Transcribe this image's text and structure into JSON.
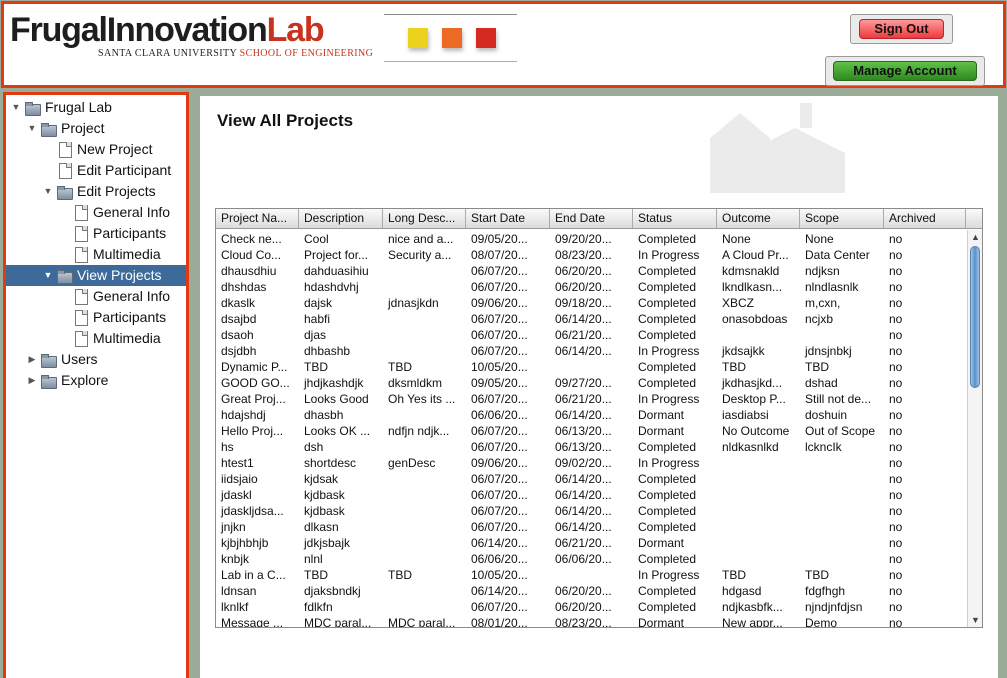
{
  "header": {
    "logo_part1": "FrugalInnovation",
    "logo_part2": "Lab",
    "logo_sub_university": "SANTA CLARA UNIVERSITY",
    "logo_sub_school": "SCHOOL OF ENGINEERING",
    "swatch_colors": [
      "#ecd21c",
      "#ec6a24",
      "#d42a22"
    ],
    "sign_out_label": "Sign Out",
    "manage_account_label": "Manage Account"
  },
  "tree": [
    {
      "label": "Frugal Lab",
      "type": "folder",
      "depth": 0,
      "expanded": true
    },
    {
      "label": "Project",
      "type": "folder",
      "depth": 1,
      "expanded": true
    },
    {
      "label": "New Project",
      "type": "page",
      "depth": 2
    },
    {
      "label": "Edit Participant",
      "type": "page",
      "depth": 2
    },
    {
      "label": "Edit Projects",
      "type": "folder",
      "depth": 2,
      "expanded": true
    },
    {
      "label": "General Info",
      "type": "page",
      "depth": 3
    },
    {
      "label": "Participants",
      "type": "page",
      "depth": 3
    },
    {
      "label": "Multimedia",
      "type": "page",
      "depth": 3
    },
    {
      "label": "View Projects",
      "type": "folder",
      "depth": 2,
      "expanded": true,
      "selected": true
    },
    {
      "label": "General Info",
      "type": "page",
      "depth": 3
    },
    {
      "label": "Participants",
      "type": "page",
      "depth": 3
    },
    {
      "label": "Multimedia",
      "type": "page",
      "depth": 3
    },
    {
      "label": "Users",
      "type": "folder",
      "depth": 1,
      "expanded": false
    },
    {
      "label": "Explore",
      "type": "folder",
      "depth": 1,
      "expanded": false
    }
  ],
  "main": {
    "title": "View All Projects",
    "columns": [
      "Project Na...",
      "Description",
      "Long Desc...",
      "Start Date",
      "End Date",
      "Status",
      "Outcome",
      "Scope",
      "Archived"
    ],
    "rows": [
      [
        "Check ne...",
        "Cool",
        "nice and a...",
        "09/05/20...",
        "09/20/20...",
        "Completed",
        "None",
        "None",
        "no"
      ],
      [
        "Cloud Co...",
        "Project for...",
        "Security a...",
        "08/07/20...",
        "08/23/20...",
        "In Progress",
        "A Cloud Pr...",
        "Data Center",
        "no"
      ],
      [
        "dhausdhiu",
        "dahduasihiu",
        "",
        "06/07/20...",
        "06/20/20...",
        "Completed",
        "kdmsnakld",
        "ndjksn",
        "no"
      ],
      [
        "dhshdas",
        "hdashdvhj",
        "",
        "06/07/20...",
        "06/20/20...",
        "Completed",
        "lkndlkasn...",
        "nlndlasnlk",
        "no"
      ],
      [
        "dkaslk",
        "dajsk",
        "jdnasjkdn",
        "09/06/20...",
        "09/18/20...",
        "Completed",
        "XBCZ",
        "m,cxn,",
        "no"
      ],
      [
        "dsajbd",
        "habfi",
        "",
        "06/07/20...",
        "06/14/20...",
        "Completed",
        "onasobdoas",
        "ncjxb",
        "no"
      ],
      [
        "dsaoh",
        "djas",
        "",
        "06/07/20...",
        "06/21/20...",
        "Completed",
        "",
        "",
        "no"
      ],
      [
        "dsjdbh",
        "dhbashb",
        "",
        "06/07/20...",
        "06/14/20...",
        "In Progress",
        "jkdsajkk",
        "jdnsjnbkj",
        "no"
      ],
      [
        "Dynamic P...",
        "TBD",
        "TBD",
        "10/05/20...",
        "",
        "Completed",
        "TBD",
        "TBD",
        "no"
      ],
      [
        "GOOD GO...",
        "jhdjkashdjk",
        "dksmldkm",
        "09/05/20...",
        "09/27/20...",
        "Completed",
        "jkdhasjkd...",
        "dshad",
        "no"
      ],
      [
        "Great Proj...",
        "Looks Good",
        "Oh Yes its ...",
        "06/07/20...",
        "06/21/20...",
        "In Progress",
        "Desktop P...",
        "Still not de...",
        "no"
      ],
      [
        "hdajshdj",
        "dhasbh",
        "",
        "06/06/20...",
        "06/14/20...",
        "Dormant",
        "iasdiabsi",
        "doshuin",
        "no"
      ],
      [
        "Hello Proj...",
        "Looks OK ...",
        "ndfjn ndjk...",
        "06/07/20...",
        "06/13/20...",
        "Dormant",
        "No Outcome",
        "Out of Scope",
        "no"
      ],
      [
        "hs",
        "dsh",
        "",
        "06/07/20...",
        "06/13/20...",
        "Completed",
        "nldkasnlkd",
        "lckncIk",
        "no"
      ],
      [
        "htest1",
        "shortdesc",
        "genDesc",
        "09/06/20...",
        "09/02/20...",
        "In Progress",
        "",
        "",
        "no"
      ],
      [
        "iidsjaio",
        "kjdsak",
        "",
        "06/07/20...",
        "06/14/20...",
        "Completed",
        "",
        "",
        "no"
      ],
      [
        "jdaskl",
        "kjdbask",
        "",
        "06/07/20...",
        "06/14/20...",
        "Completed",
        "",
        "",
        "no"
      ],
      [
        "jdaskljdsa...",
        "kjdbask",
        "",
        "06/07/20...",
        "06/14/20...",
        "Completed",
        "",
        "",
        "no"
      ],
      [
        "jnjkn",
        "dlkasn",
        "",
        "06/07/20...",
        "06/14/20...",
        "Completed",
        "",
        "",
        "no"
      ],
      [
        "kjbjhbhjb",
        "jdkjsbajk",
        "",
        "06/14/20...",
        "06/21/20...",
        "Dormant",
        "",
        "",
        "no"
      ],
      [
        "knbjk",
        "nlnl",
        "",
        "06/06/20...",
        "06/06/20...",
        "Completed",
        "",
        "",
        "no"
      ],
      [
        "Lab in a C...",
        "TBD",
        "TBD",
        "10/05/20...",
        "",
        "In Progress",
        "TBD",
        "TBD",
        "no"
      ],
      [
        "ldnsan",
        "djaksbndkj",
        "",
        "06/14/20...",
        "06/20/20...",
        "Completed",
        "hdgasd",
        "fdgfhgh",
        "no"
      ],
      [
        "lknlkf",
        "fdlkfn",
        "",
        "06/07/20...",
        "06/20/20...",
        "Completed",
        "ndjkasbfk...",
        "njndjnfdjsn",
        "no"
      ],
      [
        "Message ...",
        "MDC paral...",
        "MDC paral...",
        "08/01/20...",
        "08/23/20...",
        "Dormant",
        "New appr...",
        "Demo",
        "no"
      ]
    ]
  }
}
